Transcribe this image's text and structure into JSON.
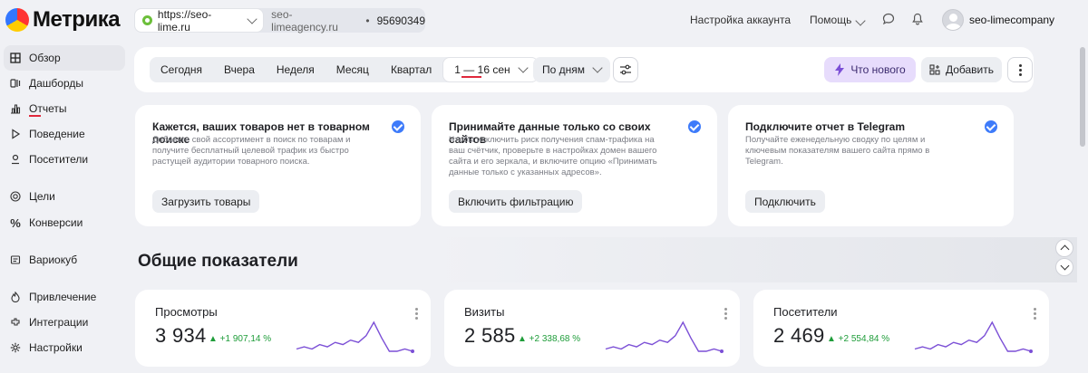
{
  "header": {
    "logo_text": "Метрика",
    "site_url": "https://seo-lime.ru",
    "site_name": "seo-limeagency.ru",
    "separator": "•",
    "counter_id": "95690349",
    "account_settings": "Настройка аккаунта",
    "help": "Помощь",
    "user_name": "seo-limecompany"
  },
  "sidebar": {
    "items": [
      {
        "label": "Обзор",
        "icon": "grid-icon"
      },
      {
        "label": "Дашборды",
        "icon": "dashboards-icon"
      },
      {
        "label": "Отчеты",
        "icon": "reports-icon"
      },
      {
        "label": "Поведение",
        "icon": "play-icon"
      },
      {
        "label": "Посетители",
        "icon": "visitor-icon"
      },
      {
        "label": "Цели",
        "icon": "target-icon"
      },
      {
        "label": "Конверсии",
        "icon": "percent-icon"
      },
      {
        "label": "Вариокуб",
        "icon": "variocube-icon"
      },
      {
        "label": "Привлечение",
        "icon": "flame-icon"
      },
      {
        "label": "Интеграции",
        "icon": "integrations-icon"
      },
      {
        "label": "Настройки",
        "icon": "gear-icon"
      }
    ]
  },
  "toolbar": {
    "periods": [
      "Сегодня",
      "Вчера",
      "Неделя",
      "Месяц",
      "Квартал"
    ],
    "date_range": "1 — 16 сен",
    "grouping": "По дням",
    "whats_new": "Что нового",
    "add": "Добавить"
  },
  "promos": [
    {
      "title": "Кажется, ваших товаров нет в товарном поиске",
      "text": "Добавьте свой ассортимент в поиск по товарам и получите бесплатный целевой трафик из быстро растущей аудитории товарного поиска.",
      "button": "Загрузить товары"
    },
    {
      "title": "Принимайте данные только со своих сайтов",
      "text": "Чтобы исключить риск получения спам-трафика на ваш счётчик, проверьте в настройках домен вашего сайта и его зеркала, и включите опцию «Принимать данные только с указанных адресов».",
      "button": "Включить фильтрацию"
    },
    {
      "title": "Подключите отчет в Telegram",
      "text": "Получайте еженедельную сводку по целям и ключевым показателям вашего сайта прямо в Telegram.",
      "button": "Подключить"
    }
  ],
  "section": {
    "title": "Общие показатели"
  },
  "metrics": [
    {
      "label": "Просмотры",
      "value": "3 934",
      "delta": "▲ +1 907,14 %",
      "trend": [
        2,
        3,
        2,
        4,
        3,
        5,
        4,
        6,
        5,
        8,
        14,
        7,
        1,
        1,
        2,
        1
      ]
    },
    {
      "label": "Визиты",
      "value": "2 585",
      "delta": "▲ +2 338,68 %",
      "trend": [
        2,
        3,
        2,
        4,
        3,
        5,
        4,
        6,
        5,
        8,
        14,
        7,
        1,
        1,
        2,
        1
      ]
    },
    {
      "label": "Посетители",
      "value": "2 469",
      "delta": "▲ +2 554,84 %",
      "trend": [
        2,
        3,
        2,
        4,
        3,
        5,
        4,
        6,
        5,
        8,
        14,
        7,
        1,
        1,
        2,
        1
      ]
    }
  ],
  "colors": {
    "accent": "#e0283c",
    "check": "#3e7bfa",
    "spark": "#7b4fd6",
    "delta": "#1f9d3a",
    "whats_new_bg": "#e7dcfc"
  }
}
